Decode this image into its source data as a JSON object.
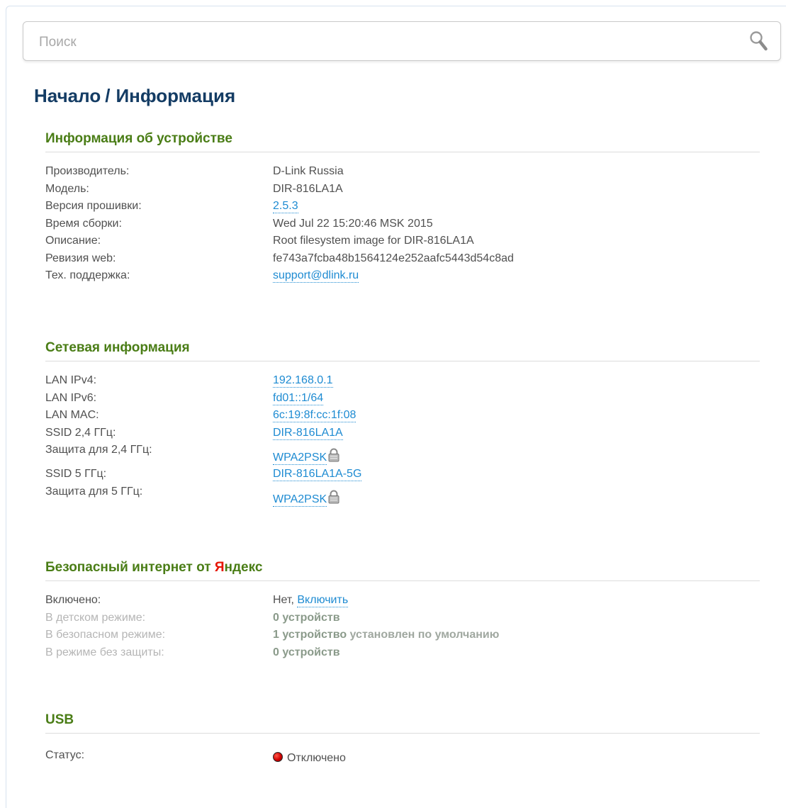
{
  "search": {
    "placeholder": "Поиск"
  },
  "breadcrumb": {
    "home": "Начало",
    "separator": "/",
    "current": "Информация"
  },
  "device_info": {
    "title": "Информация об устройстве",
    "rows": [
      {
        "label": "Производитель:",
        "value": "D-Link Russia"
      },
      {
        "label": "Модель:",
        "value": "DIR-816LA1A"
      },
      {
        "label": "Версия прошивки:",
        "value": "2.5.3"
      },
      {
        "label": "Время сборки:",
        "value": "Wed Jul 22 15:20:46 MSK 2015"
      },
      {
        "label": "Описание:",
        "value": "Root filesystem image for DIR-816LA1A"
      },
      {
        "label": "Ревизия web:",
        "value": "fe743a7fcba48b1564124e252aafc5443d54c8ad"
      },
      {
        "label": "Тех. поддержка:",
        "value": "support@dlink.ru"
      }
    ]
  },
  "network_info": {
    "title": "Сетевая информация",
    "rows": [
      {
        "label": "LAN IPv4:",
        "value": "192.168.0.1"
      },
      {
        "label": "LAN IPv6:",
        "value": "fd01::1/64"
      },
      {
        "label": "LAN MAC:",
        "value": "6c:19:8f:cc:1f:08"
      },
      {
        "label": "SSID 2,4 ГГц:",
        "value": "DIR-816LA1A"
      },
      {
        "label": "Защита для 2,4 ГГц:",
        "value": "WPA2PSK"
      },
      {
        "label": "SSID 5 ГГц:",
        "value": "DIR-816LA1A-5G"
      },
      {
        "label": "Защита для 5 ГГц:",
        "value": "WPA2PSK"
      }
    ]
  },
  "yandex": {
    "title_prefix": "Безопасный интернет от ",
    "title_brand_first": "Я",
    "title_brand_rest": "ндекс",
    "enabled": {
      "label": "Включено:",
      "value": "Нет,",
      "action": "Включить"
    },
    "rows": [
      {
        "label": "В детском режиме:",
        "value": "0 устройств",
        "note": ""
      },
      {
        "label": "В безопасном режиме:",
        "value": "1 устройство",
        "note": "установлен по умолчанию"
      },
      {
        "label": "В режиме без защиты:",
        "value": "0 устройств",
        "note": ""
      }
    ]
  },
  "usb": {
    "title": "USB",
    "status_label": "Статус:",
    "status_value": "Отключено",
    "status_color": "#d00000"
  },
  "colors": {
    "section_title": "#4a7d16",
    "breadcrumb": "#143c64",
    "link": "#1e8bd2",
    "yandex_red": "#e61400"
  }
}
